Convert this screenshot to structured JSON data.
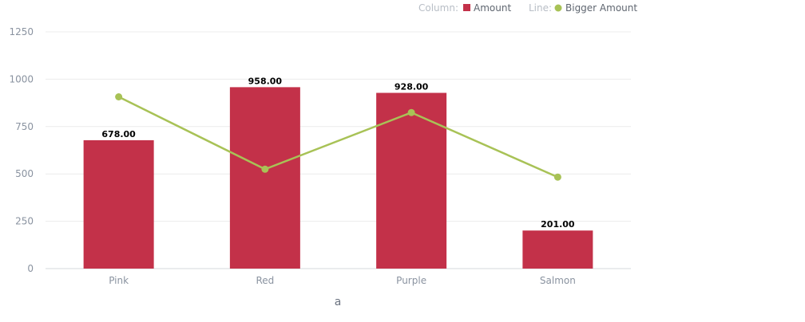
{
  "chart_data": {
    "type": "bar",
    "xlabel": "a",
    "ylabel": "",
    "ylim": [
      0,
      1250
    ],
    "yticks": [
      0,
      250,
      500,
      750,
      1000,
      1250
    ],
    "grid": true,
    "legend_position": "top-right",
    "categories": [
      "Pink",
      "Red",
      "Purple",
      "Salmon"
    ],
    "legend": {
      "column_prefix": "Column:",
      "line_prefix": "Line:"
    },
    "series": [
      {
        "name": "Amount",
        "type": "bar",
        "color": "#c33149",
        "values": [
          678,
          958,
          928,
          201
        ],
        "data_labels": [
          "678.00",
          "958.00",
          "928.00",
          "201.00"
        ]
      },
      {
        "name": "Bigger Amount",
        "type": "line",
        "color": "#a8c256",
        "values": [
          907,
          525,
          824,
          483
        ]
      }
    ]
  }
}
